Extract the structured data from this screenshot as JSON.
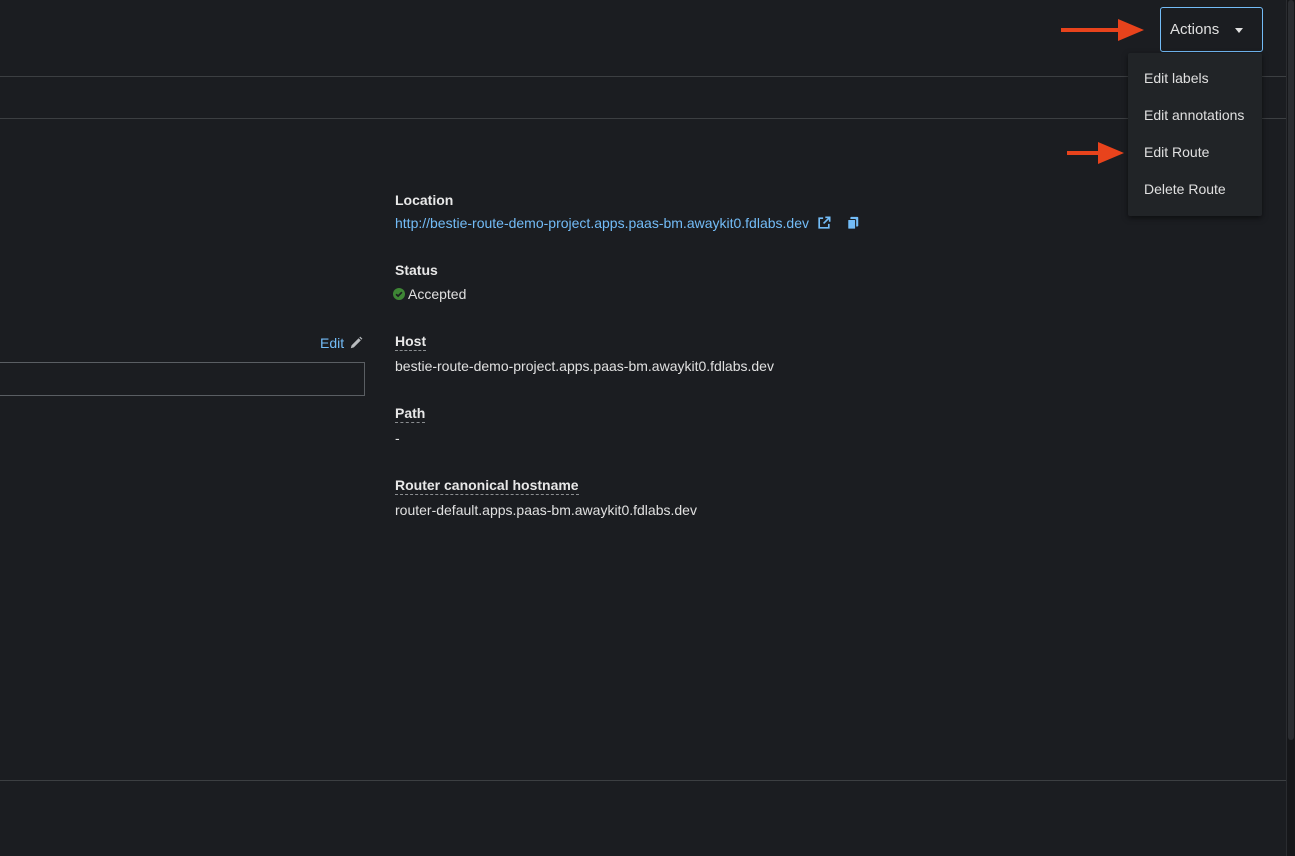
{
  "header": {
    "actions_label": "Actions"
  },
  "actions_menu": {
    "items": [
      {
        "label": "Edit labels"
      },
      {
        "label": "Edit annotations"
      },
      {
        "label": "Edit Route"
      },
      {
        "label": "Delete Route"
      }
    ]
  },
  "annotations": {
    "arrow_color": "#e8431c"
  },
  "left_panel": {
    "edit_label": "Edit"
  },
  "details": {
    "location": {
      "label": "Location",
      "value": "http://bestie-route-demo-project.apps.paas-bm.awaykit0.fdlabs.dev"
    },
    "status": {
      "label": "Status",
      "value": "Accepted",
      "color": "#3e8635"
    },
    "host": {
      "label": "Host",
      "value": "bestie-route-demo-project.apps.paas-bm.awaykit0.fdlabs.dev"
    },
    "path": {
      "label": "Path",
      "value": "-"
    },
    "router_canonical_hostname": {
      "label": "Router canonical hostname",
      "value": "router-default.apps.paas-bm.awaykit0.fdlabs.dev"
    }
  },
  "colors": {
    "background": "#1b1d21",
    "link": "#73bcf7",
    "button_border": "#73bcf7"
  }
}
